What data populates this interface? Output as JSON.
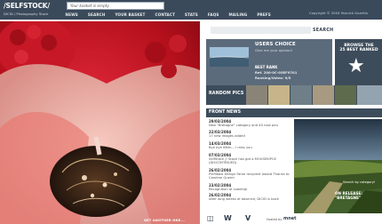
{
  "header": {
    "logo": "/SELFSTOCK/",
    "logo_sub": "DICID / Photography Stock",
    "basket_status": "Your basket is empty",
    "copyright": "Copyright © 2004 Yannick Guerilla"
  },
  "nav": {
    "items": [
      "NEWS",
      "SEARCH",
      "YOUR BASKET",
      "CONTACT",
      "STATS",
      "FAQS",
      "MAILING",
      "PREFS"
    ]
  },
  "hero": {
    "caption": "GET ANOTHER ONE..."
  },
  "search": {
    "button_label": "SEARCH",
    "value": "",
    "placeholder": ""
  },
  "users_choice": {
    "title": "USERS CHOICE",
    "subtitle": "Give me your opinion!",
    "rank": "BEST RANK",
    "ref": "Ref. 200-0C-05EF9701",
    "votes": "Ranking/Votes: 9/5"
  },
  "browse": {
    "line1": "BROWSE THE",
    "line2": "25 BEST RANKED",
    "icon": "star-icon"
  },
  "random_pics": {
    "label": "RANDOM PICS"
  },
  "front_news": {
    "label": "FRONT NEWS",
    "items": [
      {
        "date": "29/03/2004",
        "text": "New \"Bretagne\" category and 40 new pics"
      },
      {
        "date": "22/03/2004",
        "text": "17 new images added"
      },
      {
        "date": "14/03/2004",
        "text": "Bye bye 68lm... I miss you"
      },
      {
        "date": "07/03/2004",
        "text": "SelfStock // Stock has got a MOUSEKIPCK (DISCONTINUED)"
      },
      {
        "date": "26/02/2004",
        "text": "Pixfilbow Design Fame recipient Award Thanks to Caroline Querel"
      },
      {
        "date": "23/02/2004",
        "text": "Recognition of Loading!"
      },
      {
        "date": "26/02/2004",
        "text": "After long weeks of absence, DICID is back"
      }
    ]
  },
  "feature": {
    "search_note": "Search by category!",
    "release_label": "ON RELEASE:",
    "release_title": "\"BRETAGNE\""
  },
  "footer": {
    "hosted_label": "Hosted by",
    "hosted_logo": "mnet"
  },
  "colors": {
    "header_bg": "#3b4a5a",
    "panel_dark": "#3d4c5b",
    "panel_mid": "#5c6b7b",
    "hero_red": "#b8121c"
  }
}
